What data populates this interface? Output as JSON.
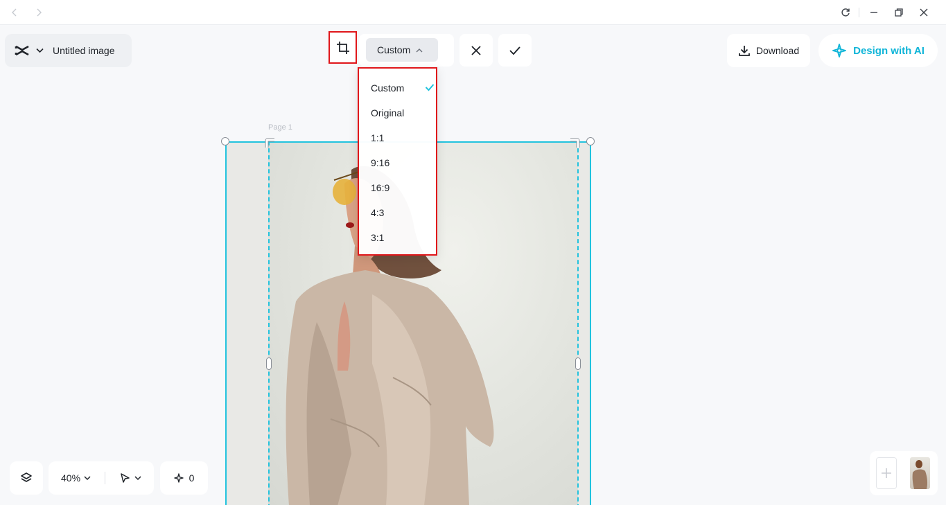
{
  "titlebar": {
    "icons": [
      "chevron-left-icon",
      "chevron-right-icon",
      "refresh-icon",
      "minimize-icon",
      "restore-icon",
      "close-icon"
    ]
  },
  "project": {
    "title": "Untitled image"
  },
  "crop_toolbar": {
    "ratio_selected": "Custom",
    "ratio_options": [
      "Custom",
      "Original",
      "1:1",
      "9:16",
      "16:9",
      "4:3",
      "3:1"
    ]
  },
  "header_right": {
    "download_label": "Download",
    "design_ai_label": "Design with AI"
  },
  "canvas": {
    "page_label": "Page 1"
  },
  "bottom_toolbar": {
    "zoom": "40%",
    "ai_count": "0"
  },
  "colors": {
    "accent": "#22c3de",
    "ai_text": "#10b5d8",
    "highlight": "#e0161a"
  }
}
